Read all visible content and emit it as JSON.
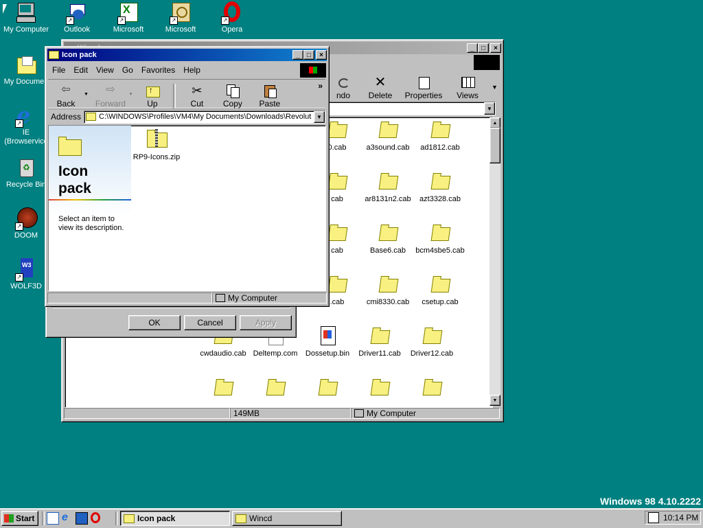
{
  "desktop": {
    "icons": [
      {
        "label": "My Computer",
        "icon": "my-computer-icon"
      },
      {
        "label": "Outlook",
        "icon": "outlook-express-icon"
      },
      {
        "label": "Microsoft",
        "icon": "excel-icon"
      },
      {
        "label": "Microsoft",
        "icon": "outlook-icon"
      },
      {
        "label": "Opera",
        "icon": "opera-icon"
      },
      {
        "label": "My Documen",
        "icon": "my-documents-icon"
      },
      {
        "label": "IE",
        "sub": "(Browservice",
        "icon": "internet-explorer-icon"
      },
      {
        "label": "Recycle Bin",
        "icon": "recycle-bin-icon"
      },
      {
        "label": "DOOM",
        "icon": "doom-icon"
      },
      {
        "label": "WOLF3D",
        "icon": "wolf3d-icon"
      }
    ],
    "version_text": "Windows 98 4.10.2222",
    "colors": {
      "desktop": "#008080",
      "title_active": "#000080",
      "title_inactive": "#808080"
    }
  },
  "back_window": {
    "title": "Wincd",
    "toolbar": [
      "ndo",
      "Delete",
      "Properties",
      "Views"
    ],
    "files": [
      {
        "name": "0.cab",
        "type": "folder-cab"
      },
      {
        "name": "a3sound.cab",
        "type": "folder-cab"
      },
      {
        "name": "ad1812.cab",
        "type": "folder-cab"
      },
      {
        "name": "cab",
        "type": "folder-cab"
      },
      {
        "name": "ar8131n2.cab",
        "type": "folder-cab"
      },
      {
        "name": "azt3328.cab",
        "type": "folder-cab"
      },
      {
        "name": "cab",
        "type": "folder-cab"
      },
      {
        "name": "Base6.cab",
        "type": "folder-cab"
      },
      {
        "name": "bcm4sbe5.cab",
        "type": "folder-cab"
      },
      {
        "name": ".cab",
        "type": "folder-cab"
      },
      {
        "name": "cmi8330.cab",
        "type": "folder-cab"
      },
      {
        "name": "csetup.cab",
        "type": "folder-cab"
      },
      {
        "name": "cwdaudio.cab",
        "type": "folder-cab"
      },
      {
        "name": "Deltemp.com",
        "type": "dos"
      },
      {
        "name": "Dossetup.bin",
        "type": "setup"
      },
      {
        "name": "Driver11.cab",
        "type": "folder-cab"
      },
      {
        "name": "Driver12.cab",
        "type": "folder-cab"
      }
    ],
    "status": {
      "size": "149MB",
      "location": "My Computer"
    }
  },
  "dialog_behind": {
    "ok": "OK",
    "cancel": "Cancel",
    "apply": "Apply"
  },
  "front_window": {
    "title": "Icon pack",
    "menu": [
      "File",
      "Edit",
      "View",
      "Go",
      "Favorites",
      "Help"
    ],
    "toolbar": {
      "back": "Back",
      "forward": "Forward",
      "up": "Up",
      "cut": "Cut",
      "copy": "Copy",
      "paste": "Paste",
      "more": "»"
    },
    "address_label": "Address",
    "address_value": "C:\\WINDOWS\\Profiles\\VM4\\My Documents\\Downloads\\Revolut",
    "web_panel": {
      "title_line1": "Icon",
      "title_line2": "pack",
      "description": "Select an item to view its description."
    },
    "files": [
      {
        "name": "RP9-Icons.zip",
        "type": "zip"
      }
    ],
    "status": {
      "location": "My Computer"
    }
  },
  "taskbar": {
    "start": "Start",
    "tasks": [
      {
        "label": "Icon pack",
        "active": true
      },
      {
        "label": "Wincd",
        "active": false
      }
    ],
    "clock": "10:14 PM"
  }
}
